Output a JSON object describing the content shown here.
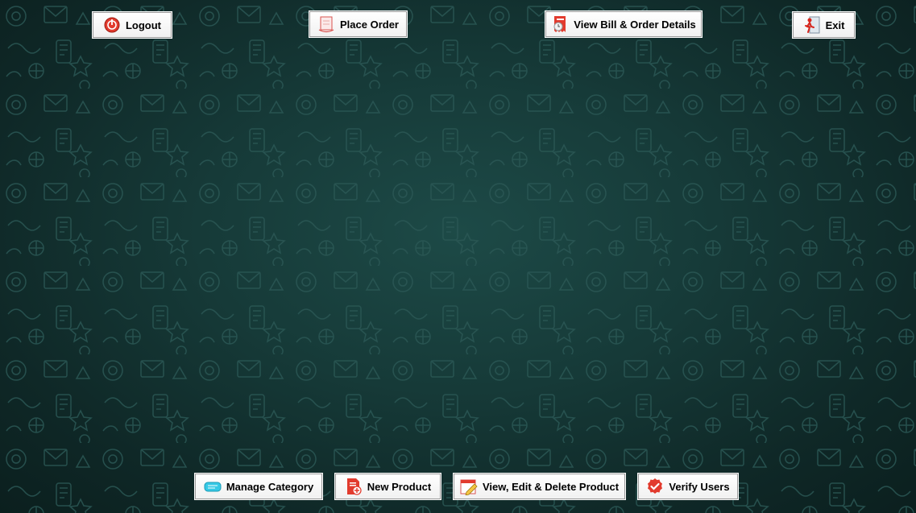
{
  "top_bar": {
    "logout_label": "Logout",
    "place_order_label": "Place Order",
    "view_bill_label": "View Bill & Order Details",
    "exit_label": "Exit"
  },
  "bottom_bar": {
    "manage_category_label": "Manage Category",
    "new_product_label": "New Product",
    "view_edit_delete_label": "View, Edit & Delete Product",
    "verify_users_label": "Verify Users"
  },
  "icons": {
    "logout": "power-icon",
    "place_order": "order-icon",
    "view_bill": "bill-icon",
    "exit": "exit-icon",
    "manage_category": "category-icon",
    "new_product": "new-product-icon",
    "view_edit_delete": "edit-icon",
    "verify_users": "verify-icon"
  },
  "colors": {
    "background": "#163a38",
    "doodle": "#2a5754",
    "button_face": "#ffffff",
    "button_border": "#9a9a9a",
    "accent_red": "#e23b2e",
    "accent_cyan": "#36c9e6"
  }
}
